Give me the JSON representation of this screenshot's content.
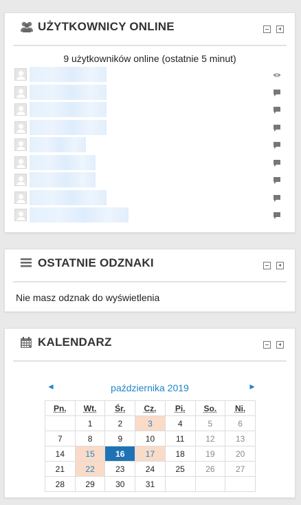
{
  "online_users": {
    "title": "UŻYTKOWNICY ONLINE",
    "summary": "9 użytkowników online (ostatnie 5 minut)",
    "rows": [
      {
        "action_icon": "eye-icon"
      },
      {
        "action_icon": "message-icon"
      },
      {
        "action_icon": "message-icon"
      },
      {
        "action_icon": "message-icon"
      },
      {
        "action_icon": "message-icon"
      },
      {
        "action_icon": "message-icon"
      },
      {
        "action_icon": "message-icon"
      },
      {
        "action_icon": "message-icon"
      },
      {
        "action_icon": "message-icon"
      }
    ]
  },
  "badges": {
    "title": "OSTATNIE ODZNAKI",
    "empty_text": "Nie masz odznak do wyświetlenia"
  },
  "calendar": {
    "title": "KALENDARZ",
    "month_label": "października 2019",
    "prev_label": "◄",
    "next_label": "►",
    "weekdays": [
      "Pn.",
      "Wt.",
      "Śr.",
      "Cz.",
      "Pi.",
      "So.",
      "Ni."
    ],
    "weeks": [
      [
        "",
        "1",
        "2",
        "3",
        "4",
        "5",
        "6"
      ],
      [
        "7",
        "8",
        "9",
        "10",
        "11",
        "12",
        "13"
      ],
      [
        "14",
        "15",
        "16",
        "17",
        "18",
        "19",
        "20"
      ],
      [
        "21",
        "22",
        "23",
        "24",
        "25",
        "26",
        "27"
      ],
      [
        "28",
        "29",
        "30",
        "31",
        "",
        "",
        ""
      ]
    ],
    "event_days": [
      "3",
      "15",
      "17",
      "22"
    ],
    "today": "16"
  },
  "colors": {
    "accent": "#1f86c7",
    "today_bg": "#1f73b5",
    "event_bg": "#fadbc8"
  }
}
